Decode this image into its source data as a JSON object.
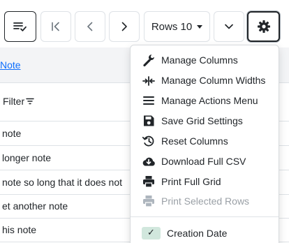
{
  "toolbar": {
    "rows_label": "Rows 10",
    "colors": {
      "border": "#dee2e6",
      "active_border": "#212529",
      "icon": "#212529",
      "icon_muted": "#6c757d"
    }
  },
  "grid": {
    "header_link": "Note",
    "filter_label": "Filter",
    "rows": [
      "note",
      "longer note",
      "note so long that it does not",
      "et another note",
      "his note"
    ]
  },
  "menu": {
    "items": [
      {
        "label": "Manage Columns",
        "icon": "wrench-icon"
      },
      {
        "label": "Manage Column Widths",
        "icon": "column-width-icon"
      },
      {
        "label": "Manage Actions Menu",
        "icon": "list-icon"
      },
      {
        "label": "Save Grid Settings",
        "icon": "floppy-disk-icon"
      },
      {
        "label": "Reset Columns",
        "icon": "history-icon"
      },
      {
        "label": "Download Full CSV",
        "icon": "cloud-download-icon"
      },
      {
        "label": "Print Full Grid",
        "icon": "printer-icon"
      },
      {
        "label": "Print Selected Rows",
        "icon": "printer-icon",
        "disabled": true
      }
    ],
    "columns": [
      {
        "label": "Creation Date",
        "checked": true,
        "check_glyph": "✓"
      }
    ],
    "colors": {
      "disabled_text": "#9aa0a6",
      "check_bg": "#d1e7dd",
      "check_mark": "#212529"
    }
  }
}
